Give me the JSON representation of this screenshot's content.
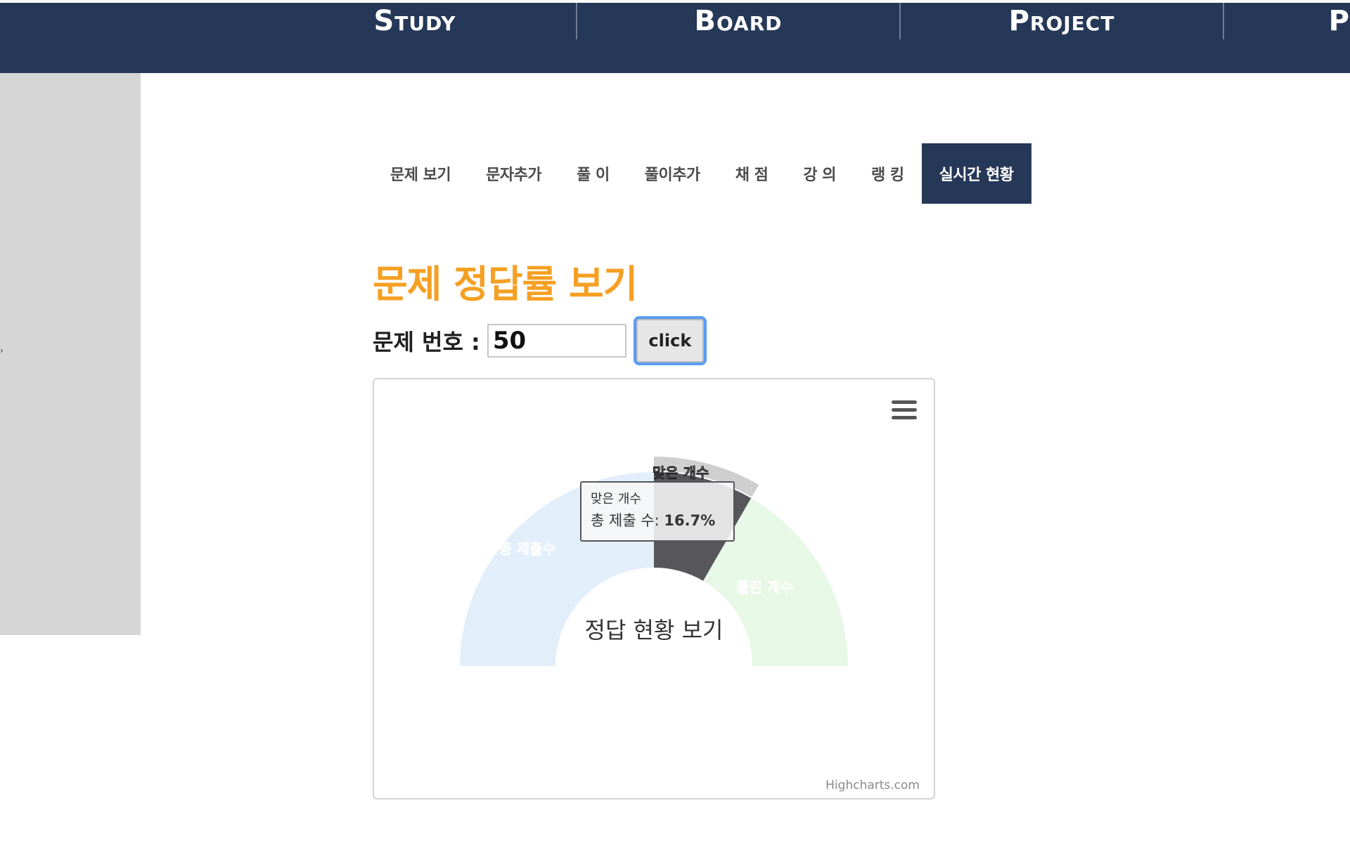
{
  "nav": {
    "items": [
      {
        "label": "Study"
      },
      {
        "label": "Board"
      },
      {
        "label": "Project"
      },
      {
        "label": "P"
      }
    ]
  },
  "subtabs": {
    "items": [
      {
        "label": "문제 보기"
      },
      {
        "label": "문자추가"
      },
      {
        "label": "풀 이"
      },
      {
        "label": "풀이추가"
      },
      {
        "label": "채 점"
      },
      {
        "label": "강 의"
      },
      {
        "label": "랭 킹"
      },
      {
        "label": "실시간 현황"
      }
    ],
    "active_index": 7
  },
  "section": {
    "title": "문제 정답률 보기"
  },
  "form": {
    "label": "문제 번호 :",
    "value": "50",
    "button_label": "click"
  },
  "chart": {
    "credits": "Highcharts.com",
    "menu_icon": "hamburger-icon"
  },
  "colors": {
    "nav_bg": "#263858",
    "title": "#f5a023",
    "series_total": "#e3eefb",
    "series_correct": "#56565b",
    "series_correct_highlight": "#cfcfcf",
    "series_wrong": "#e8f8e6"
  },
  "chart_data": {
    "type": "pie",
    "title": "정답 현황 보기",
    "categories": [
      "총 제출수",
      "맞은 개수",
      "틀린 개수"
    ],
    "series": [
      {
        "values": [
          50,
          16.7,
          33.3
        ]
      }
    ],
    "tooltip": {
      "header": "맞은 개수",
      "label": "총 제출 수: ",
      "value": "16.7%"
    }
  }
}
